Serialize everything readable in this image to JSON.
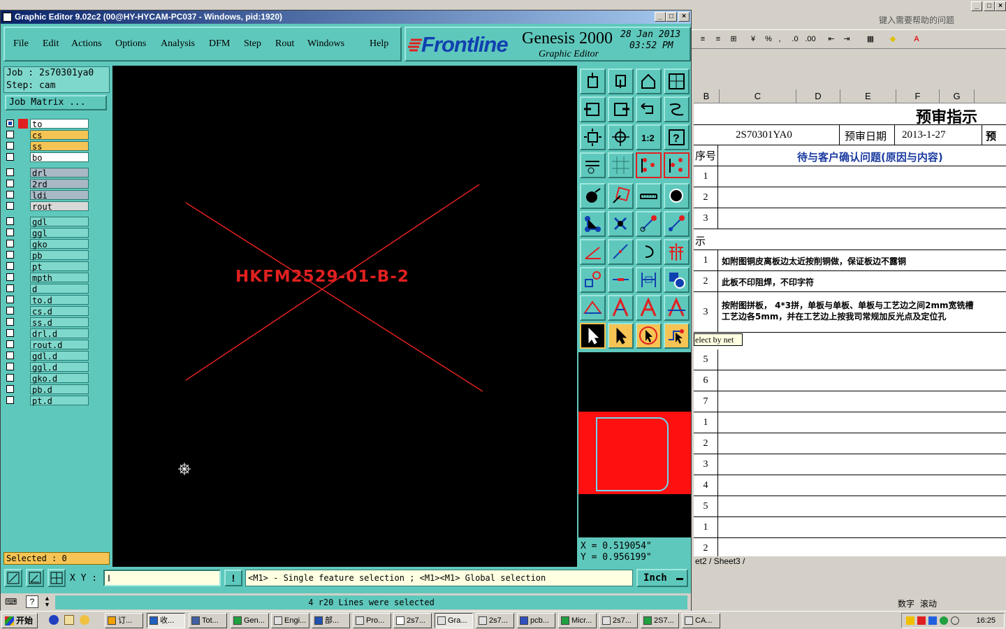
{
  "excel": {
    "help_placeholder": "键入需要帮助的问题",
    "columns": [
      "B",
      "C",
      "D",
      "E",
      "F",
      "G"
    ],
    "title": "预审指示",
    "header_row": {
      "job": "2S70301YA0",
      "date_label": "预审日期",
      "date": "2013-1-27",
      "trailing": "预"
    },
    "label_col": "序号",
    "label_text": "待与客户确认问题(原因与内容)",
    "rows_top": [
      "1",
      "2",
      "3"
    ],
    "section_label": "示",
    "rows_instructions": [
      {
        "n": "1",
        "text": "如附图铜皮离板边太近按削铜做，保证板边不露铜"
      },
      {
        "n": "2",
        "text": "此板不印阻焊，不印字符"
      },
      {
        "n": "3",
        "text": "按附图拼板， 4*3拼，单板与单板、单板与工艺边之间2mm宽铣槽",
        "text2": "工艺边各5mm，并在工艺边上按我司常规加反光点及定位孔"
      }
    ],
    "rows_bottom": [
      "5",
      "6",
      "7",
      "1",
      "2",
      "3",
      "4",
      "5",
      "1",
      "2"
    ],
    "tooltip": "elect by net",
    "sheet_tabs": "et2 / Sheet3 /",
    "status_items": [
      "数字",
      "滚动"
    ],
    "toolbar_items": [
      "%",
      ","
    ]
  },
  "genesis": {
    "title": "Graphic Editor 9.02c2 (00@HY-HYCAM-PC037 - Windows, pid:1920)",
    "menu": [
      "File",
      "Edit",
      "Actions",
      "Options",
      "Analysis",
      "DFM",
      "Step",
      "Rout",
      "Windows",
      "Help"
    ],
    "logo": {
      "brand": "Frontline",
      "product": "Genesis 2000",
      "subtitle": "Graphic Editor",
      "date": "28 Jan 2013",
      "time": "03:52 PM"
    },
    "job": {
      "job_line": "Job : 2s70301ya0",
      "step_line": "Step: cam"
    },
    "job_matrix": "Job Matrix ...",
    "layers": [
      {
        "name": "to",
        "color": "#ffffff",
        "checked": true,
        "swatch": "#e02020"
      },
      {
        "name": "cs",
        "color": "#f6c454",
        "checked": false
      },
      {
        "name": "ss",
        "color": "#f6c454",
        "checked": false
      },
      {
        "name": "bo",
        "color": "#ffffff",
        "checked": false
      },
      {
        "name": "drl",
        "color": "#a8b8c4",
        "checked": false
      },
      {
        "name": "2rd",
        "color": "#a8b8c4",
        "checked": false
      },
      {
        "name": "ldi",
        "color": "#a8b8c4",
        "checked": false
      },
      {
        "name": "rout",
        "color": "#d8d8d8",
        "checked": false
      },
      {
        "name": "gdl",
        "color": "#7fd8cc",
        "checked": false
      },
      {
        "name": "ggl",
        "color": "#7fd8cc",
        "checked": false
      },
      {
        "name": "gko",
        "color": "#7fd8cc",
        "checked": false
      },
      {
        "name": "pb",
        "color": "#7fd8cc",
        "checked": false
      },
      {
        "name": "pt",
        "color": "#7fd8cc",
        "checked": false
      },
      {
        "name": "mpth",
        "color": "#7fd8cc",
        "checked": false
      },
      {
        "name": "d",
        "color": "#7fd8cc",
        "checked": false
      },
      {
        "name": "to.d",
        "color": "#7fd8cc",
        "checked": false
      },
      {
        "name": "cs.d",
        "color": "#7fd8cc",
        "checked": false
      },
      {
        "name": "ss.d",
        "color": "#7fd8cc",
        "checked": false
      },
      {
        "name": "drl.d",
        "color": "#7fd8cc",
        "checked": false
      },
      {
        "name": "rout.d",
        "color": "#7fd8cc",
        "checked": false
      },
      {
        "name": "gdl.d",
        "color": "#7fd8cc",
        "checked": false
      },
      {
        "name": "ggl.d",
        "color": "#7fd8cc",
        "checked": false
      },
      {
        "name": "gko.d",
        "color": "#7fd8cc",
        "checked": false
      },
      {
        "name": "pb.d",
        "color": "#7fd8cc",
        "checked": false
      },
      {
        "name": "pt.d",
        "color": "#7fd8cc",
        "checked": false
      }
    ],
    "selected": "Selected : 0",
    "canvas_text": "HKFM2529-01-B-2",
    "canvas_color": "#e02020",
    "coords": {
      "x": "X = 0.519054\"",
      "y": "Y = 0.956199\""
    },
    "xy_label": "X Y :",
    "prompt": "<M1> - Single feature selection ; <M1><M1> Global selection",
    "unit": "Inch",
    "status": "4 r20 Lines were selected",
    "excl": "!"
  },
  "taskbar": {
    "start": "开始",
    "tasks": [
      "订...",
      "收...",
      "Tot...",
      "Gen...",
      "Engi...",
      "部...",
      "Pro...",
      "2s7...",
      "Gra...",
      "2s7...",
      "pcb...",
      "Micr...",
      "2s7...",
      "2S7...",
      "CA..."
    ],
    "clock": "16:25"
  }
}
